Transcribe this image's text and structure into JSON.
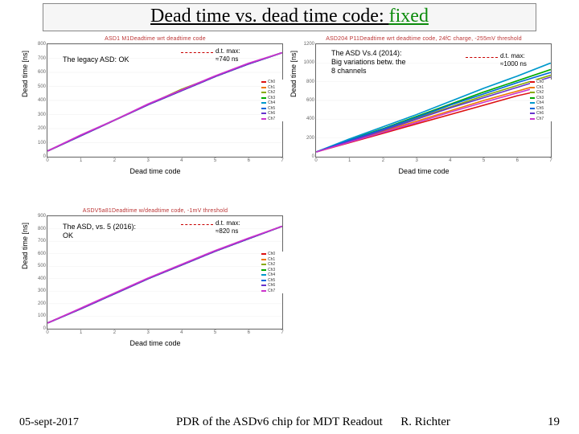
{
  "title": {
    "prefix": "Dead time vs. dead time code: ",
    "fixed": "fixed"
  },
  "axis": {
    "y": "Dead time [ns]",
    "x": "Dead time code"
  },
  "footer": {
    "date": "05-sept-2017",
    "center": "PDR of the ASDv6 chip for MDT Readout",
    "author": "R. Richter",
    "page": "19"
  },
  "legend_labels": [
    "Ch0",
    "Ch1",
    "Ch2",
    "Ch3",
    "Ch4",
    "Ch5",
    "Ch6",
    "Ch7"
  ],
  "series_colors": [
    "#d11",
    "#e70",
    "#8a0",
    "#0a0",
    "#09c",
    "#06d",
    "#63c",
    "#c3c"
  ],
  "charts": [
    {
      "plot_title": "ASD1 M1Deadtime wrt deadtime code",
      "anno_main": "The legacy ASD: OK",
      "anno_dt": "d.t. max:\n≈740 ns",
      "yticks": [
        0,
        100,
        200,
        300,
        400,
        500,
        600,
        700,
        800
      ],
      "xticks": [
        0,
        1,
        2,
        3,
        4,
        5,
        6,
        7
      ]
    },
    {
      "plot_title": "ASD204 P11Deadtime wrt deadtime code, 24fC charge, -255mV threshold",
      "anno_main": "The ASD Vs.4 (2014):\nBig variations betw. the\n8 channels",
      "anno_dt": "d.t. max:\n≈1000 ns",
      "yticks": [
        0,
        200,
        400,
        600,
        800,
        1000,
        1200
      ],
      "xticks": [
        0,
        1,
        2,
        3,
        4,
        5,
        6,
        7
      ]
    },
    {
      "plot_title": "ASDV5a81Deadtime w/deadtime code, -1mV threshold",
      "anno_main": "The ASD, vs. 5 (2016):\nOK",
      "anno_dt": "d.t. max:\n≈820 ns",
      "yticks": [
        0,
        100,
        200,
        300,
        400,
        500,
        600,
        700,
        800,
        900
      ],
      "xticks": [
        0,
        1,
        2,
        3,
        4,
        5,
        6,
        7
      ]
    }
  ],
  "chart_data": [
    {
      "type": "line",
      "title": "ASD1 M1 Deadtime vs deadtime code",
      "xlabel": "Dead time code",
      "ylabel": "Dead time [ns]",
      "xlim": [
        0,
        7
      ],
      "ylim": [
        0,
        800
      ],
      "x": [
        0,
        1,
        2,
        3,
        4,
        5,
        6,
        7
      ],
      "series": [
        {
          "name": "Ch0",
          "values": [
            40,
            150,
            260,
            370,
            470,
            570,
            660,
            740
          ]
        },
        {
          "name": "Ch1",
          "values": [
            40,
            150,
            260,
            370,
            470,
            570,
            660,
            740
          ]
        },
        {
          "name": "Ch2",
          "values": [
            40,
            150,
            260,
            370,
            480,
            570,
            660,
            740
          ]
        },
        {
          "name": "Ch3",
          "values": [
            40,
            150,
            260,
            370,
            470,
            570,
            660,
            740
          ]
        },
        {
          "name": "Ch4",
          "values": [
            40,
            150,
            260,
            370,
            470,
            570,
            660,
            740
          ]
        },
        {
          "name": "Ch5",
          "values": [
            40,
            150,
            260,
            370,
            470,
            570,
            660,
            740
          ]
        },
        {
          "name": "Ch6",
          "values": [
            40,
            150,
            260,
            370,
            470,
            570,
            660,
            740
          ]
        },
        {
          "name": "Ch7",
          "values": [
            40,
            155,
            260,
            375,
            475,
            575,
            665,
            740
          ]
        }
      ]
    },
    {
      "type": "line",
      "title": "ASD204 P11 Deadtime vs deadtime code",
      "xlabel": "Dead time code",
      "ylabel": "Dead time [ns]",
      "xlim": [
        0,
        7
      ],
      "ylim": [
        0,
        1200
      ],
      "x": [
        0,
        1,
        2,
        3,
        4,
        5,
        6,
        7
      ],
      "series": [
        {
          "name": "Ch0",
          "values": [
            50,
            150,
            250,
            350,
            450,
            550,
            650,
            730
          ]
        },
        {
          "name": "Ch1",
          "values": [
            50,
            160,
            270,
            380,
            490,
            600,
            700,
            800
          ]
        },
        {
          "name": "Ch2",
          "values": [
            50,
            170,
            290,
            410,
            530,
            650,
            760,
            870
          ]
        },
        {
          "name": "Ch3",
          "values": [
            50,
            180,
            300,
            430,
            560,
            690,
            810,
            930
          ]
        },
        {
          "name": "Ch4",
          "values": [
            50,
            190,
            320,
            450,
            590,
            730,
            860,
            1000
          ]
        },
        {
          "name": "Ch5",
          "values": [
            50,
            175,
            295,
            420,
            550,
            670,
            790,
            900
          ]
        },
        {
          "name": "Ch6",
          "values": [
            50,
            165,
            280,
            400,
            520,
            630,
            740,
            850
          ]
        },
        {
          "name": "Ch7",
          "values": [
            50,
            155,
            260,
            365,
            475,
            580,
            680,
            780
          ]
        }
      ]
    },
    {
      "type": "line",
      "title": "ASDV5a81 Deadtime vs deadtime code",
      "xlabel": "Dead time code",
      "ylabel": "Dead time [ns]",
      "xlim": [
        0,
        7
      ],
      "ylim": [
        0,
        900
      ],
      "x": [
        0,
        1,
        2,
        3,
        4,
        5,
        6,
        7
      ],
      "series": [
        {
          "name": "Ch0",
          "values": [
            45,
            160,
            280,
            400,
            510,
            620,
            720,
            820
          ]
        },
        {
          "name": "Ch1",
          "values": [
            45,
            160,
            280,
            400,
            510,
            620,
            720,
            820
          ]
        },
        {
          "name": "Ch2",
          "values": [
            45,
            160,
            280,
            400,
            510,
            620,
            720,
            820
          ]
        },
        {
          "name": "Ch3",
          "values": [
            45,
            160,
            280,
            400,
            510,
            620,
            720,
            820
          ]
        },
        {
          "name": "Ch4",
          "values": [
            45,
            160,
            280,
            400,
            510,
            620,
            720,
            820
          ]
        },
        {
          "name": "Ch5",
          "values": [
            45,
            160,
            280,
            400,
            510,
            620,
            720,
            820
          ]
        },
        {
          "name": "Ch6",
          "values": [
            45,
            160,
            280,
            400,
            510,
            620,
            720,
            820
          ]
        },
        {
          "name": "Ch7",
          "values": [
            45,
            165,
            285,
            405,
            515,
            625,
            725,
            820
          ]
        }
      ]
    }
  ]
}
